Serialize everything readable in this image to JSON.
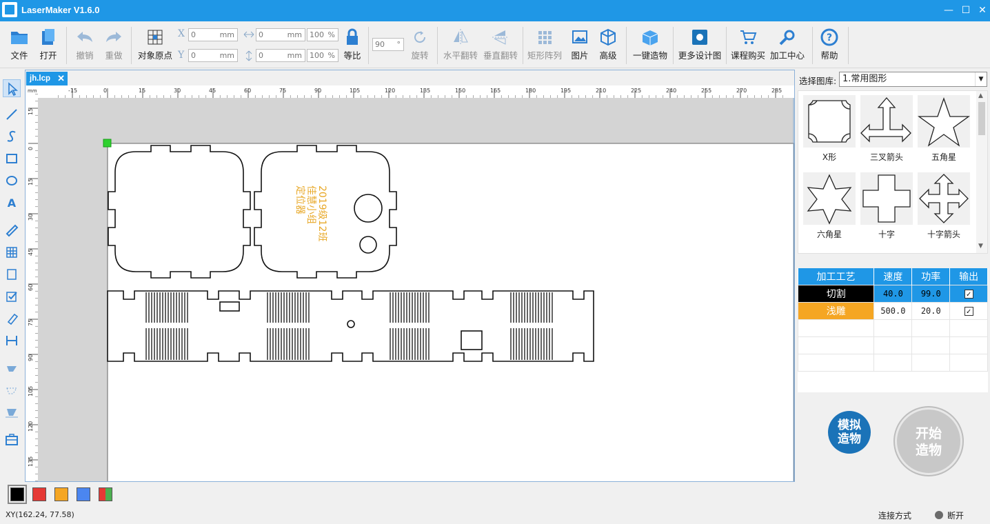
{
  "window": {
    "title": "LaserMaker V1.6.0",
    "min": "—",
    "max": "☐",
    "close": "✕"
  },
  "toolbar": {
    "file": "文件",
    "open": "打开",
    "undo": "撤销",
    "redo": "重做",
    "origin": "对象原点",
    "x_label": "X",
    "y_label": "Y",
    "x_value": "0",
    "y_value": "0",
    "w_value": "0",
    "h_value": "0",
    "unit_mm": "mm",
    "w_pct": "100",
    "h_pct": "100",
    "pct": "%",
    "ratio": "等比",
    "rotate_value": "90",
    "deg": "°",
    "rotate": "旋转",
    "hflip": "水平翻转",
    "vflip": "垂直翻转",
    "array": "矩形阵列",
    "image": "图片",
    "advanced": "高级",
    "one_click": "一键造物",
    "more_designs": "更多设计图",
    "buy_course": "课程购买",
    "center": "加工中心",
    "help": "帮助"
  },
  "document": {
    "tab": "jh.lcp",
    "tab_close": "✕",
    "ruler_unit": "mm",
    "ruler_x": [
      "-15",
      "0",
      "15",
      "30",
      "45",
      "60",
      "75",
      "90",
      "105",
      "120",
      "135",
      "150",
      "165",
      "180",
      "195",
      "210",
      "225",
      "240",
      "255",
      "270",
      "285"
    ],
    "ruler_y": [
      "15",
      "0",
      "15",
      "30",
      "45",
      "60",
      "75",
      "90",
      "105",
      "120",
      "135"
    ],
    "engrave_text": [
      "2019级12班",
      "佳慧小组",
      "定位器"
    ]
  },
  "library": {
    "label": "选择图库:",
    "selected": "1.常用图形",
    "shapes": [
      {
        "name": "X形",
        "icon": "x-shape-icon"
      },
      {
        "name": "三叉箭头",
        "icon": "trident-arrow-icon"
      },
      {
        "name": "五角星",
        "icon": "five-star-icon"
      },
      {
        "name": "六角星",
        "icon": "six-star-icon"
      },
      {
        "name": "十字",
        "icon": "cross-icon"
      },
      {
        "name": "十字箭头",
        "icon": "cross-arrow-icon"
      }
    ]
  },
  "process": {
    "headers": [
      "加工工艺",
      "速度",
      "功率",
      "输出"
    ],
    "rows": [
      {
        "name": "切割",
        "speed": "40.0",
        "power": "99.0",
        "color": "#000000",
        "checked": true
      },
      {
        "name": "浅雕",
        "speed": "500.0",
        "power": "20.0",
        "color": "#f5a623",
        "checked": true
      }
    ]
  },
  "actions": {
    "simulate": [
      "模拟",
      "造物"
    ],
    "start": [
      "开始",
      "造物"
    ]
  },
  "colors": [
    "#000000",
    "#e53935",
    "#f5a623",
    "#4b86f0",
    "multi"
  ],
  "status": {
    "xy": "XY(162.24, 77.58)",
    "connect": "连接方式",
    "state": "断开"
  }
}
